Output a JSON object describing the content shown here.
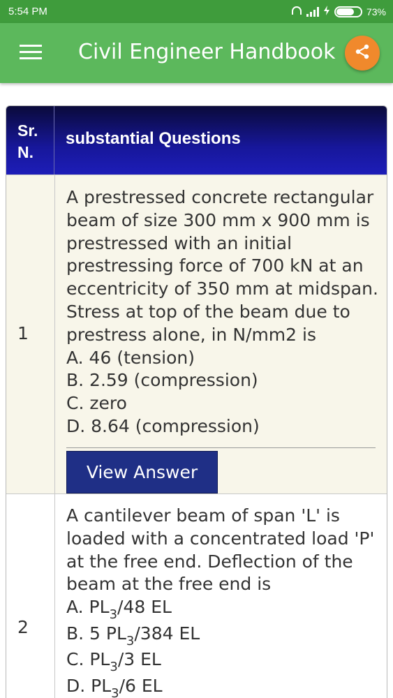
{
  "status_bar": {
    "time": "5:54 PM",
    "battery": "73%"
  },
  "app_bar": {
    "title": "Civil Engineer Handbook",
    "menu_icon": "hamburger-menu-icon",
    "share_icon": "share-icon",
    "accent_color": "#5cb85c",
    "share_color": "#f0892c"
  },
  "table": {
    "header_sr": [
      "Sr.",
      "N."
    ],
    "header_question": "substantial Questions",
    "header_color": "#1d1db8",
    "rows": [
      {
        "number": "1",
        "question_lines": [
          "A prestressed concrete rectangular",
          "beam of size 300 mm x 900 mm is",
          "prestressed with an initial",
          "prestressing force of 700 kN at an",
          "eccentricity of 350 mm at midspan.",
          "Stress at top of the beam due to",
          "prestress alone, in N/mm2 is"
        ],
        "options": [
          "A. 46 (tension)",
          "B. 2.59 (compression)",
          "C. zero",
          "D. 8.64 (compression)"
        ],
        "button": "View Answer"
      },
      {
        "number": "2",
        "question_lines": [
          "A cantilever beam of span 'L' is",
          "loaded with a concentrated load 'P'",
          "at the free end. Deflection of the",
          "beam at the free end is"
        ],
        "options": [
          {
            "pre": "A. PL",
            "sub": "3",
            "post": "/48 EL"
          },
          {
            "pre": "B. 5 PL",
            "sub": "3",
            "post": "/384 EL"
          },
          {
            "pre": "C. PL",
            "sub": "3",
            "post": "/3 EL"
          },
          {
            "pre": "D. PL",
            "sub": "3",
            "post": "/6 EL"
          }
        ]
      }
    ]
  }
}
